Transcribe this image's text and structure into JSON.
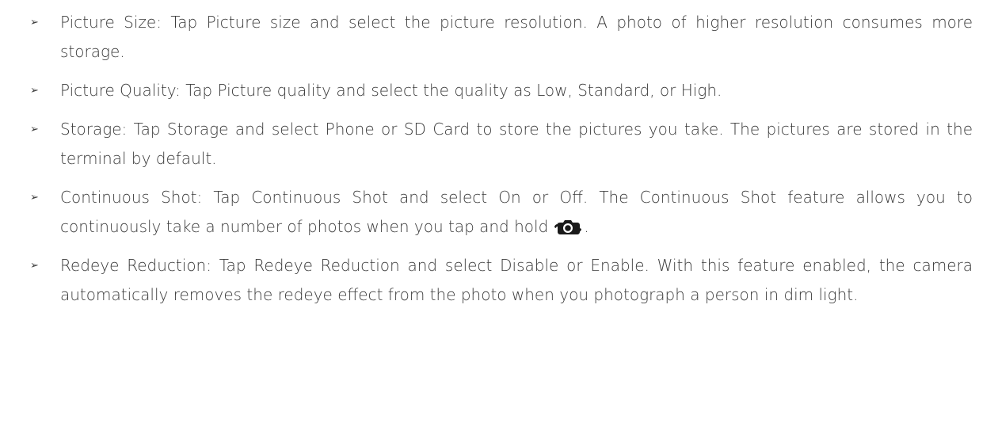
{
  "bullets": [
    {
      "text": "Picture Size: Tap Picture size and select the picture resolution. A photo of higher resolution consumes more storage."
    },
    {
      "text": "Picture Quality: Tap Picture quality and select the quality as Low, Standard, or High."
    },
    {
      "text": "Storage: Tap Storage and select Phone or SD Card to store the pictures you take. The pictures are stored in the terminal by default."
    },
    {
      "text": "Continuous Shot: Tap Continuous Shot and select On or Off. The Continuous Shot feature allows you to continuously take a number of photos when you tap and hold",
      "icon": "continuous-shot-camera-icon",
      "suffix": "."
    },
    {
      "text": "Redeye Reduction: Tap Redeye Reduction and select Disable or Enable. With this feature enabled, the camera automatically removes the redeye effect from the photo when you photograph a person in dim light."
    }
  ],
  "bullet_marker": "➢"
}
